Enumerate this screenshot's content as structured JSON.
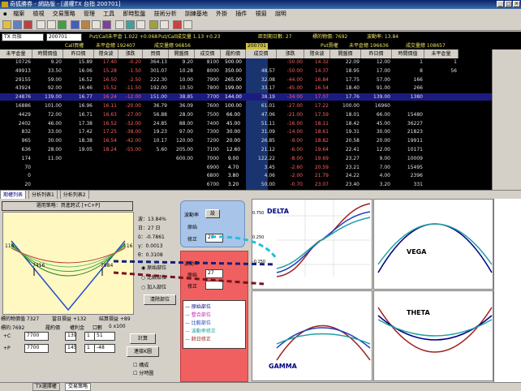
{
  "window": {
    "title": "奇狐勝券 - 網路版 - [選權TX 台指 200701]"
  },
  "menu": [
    "檔案",
    "檢視",
    "交易策略",
    "管理",
    "工具",
    "即時監盤",
    "技術分析",
    "訓練基地",
    "外掛",
    "插件",
    "視窗",
    "說明"
  ],
  "infobar": {
    "product": "TX 台指",
    "month": "200701",
    "call_info": "Put/Call未平倉 1.022 +0.068",
    "put_info": "Put/Call成交量 1.13 +0.23",
    "days_label": "距到期日數: 27",
    "underlying": "標的物價: 7692",
    "volatility": "波動率: 13.84"
  },
  "subheader": {
    "call_label": "Call買權",
    "call_oi": "未平倉總 192407",
    "call_vol": "成交量總 96856",
    "month": "200701",
    "put_label": "Put賣權",
    "put_oi": "未平倉總 196636",
    "put_vol": "成交量總 108657"
  },
  "grid": {
    "headers": [
      "未平倉量",
      "時間價值",
      "昨日價",
      "隱含波",
      "漲跌",
      "買價",
      "開盤價",
      "成交價",
      "履約價",
      "成交價",
      "漲跌",
      "隱含波",
      "開盤價",
      "昨日價",
      "時間價值",
      "未平倉量"
    ],
    "rows": [
      [
        "10726",
        "9.20",
        "15.89",
        "17.40",
        "-0.20",
        "364.13",
        "9.20",
        "8100",
        "500.00",
        "",
        "-50.00",
        "14.32",
        "22.09",
        "12.00",
        "1",
        "1"
      ],
      [
        "49913",
        "33.50",
        "16.06",
        "15.28",
        "-1.50",
        "301.07",
        "10.28",
        "8000",
        "350.00",
        "48.57",
        "-50.00",
        "14.37",
        "18.95",
        "17.00",
        "8",
        "56"
      ],
      [
        "29155",
        "59.00",
        "16.52",
        "16.50",
        "-2.50",
        "222.30",
        "10.00",
        "7900",
        "265.00",
        "32.08",
        "-44.00",
        "16.84",
        "17.75",
        "57.00",
        "166",
        ""
      ],
      [
        "43924",
        "92.00",
        "16.46",
        "15.52",
        "-11.50",
        "192.00",
        "10.50",
        "7800",
        "199.00",
        "33.17",
        "-45.00",
        "16.54",
        "18.40",
        "91.00",
        "266",
        ""
      ],
      [
        "24876",
        "139.00",
        "16.77",
        "16.24",
        "-12.00",
        "151.00",
        "38.85",
        "7700",
        "144.00",
        "38.19",
        "-34.00",
        "17.07",
        "17.76",
        "139.00",
        "1380",
        ""
      ],
      [
        "16886",
        "101.00",
        "16.96",
        "16.11",
        "-20.00",
        "36.79",
        "36.09",
        "7600",
        "100.00",
        "61.01",
        "-27.00",
        "17.22",
        "100.00",
        "16960",
        ""
      ],
      [
        "4429",
        "72.00",
        "16.71",
        "16.63",
        "-27.00",
        "56.88",
        "28.00",
        "7500",
        "66.00",
        "47.06",
        "-21.00",
        "17.59",
        "18.01",
        "66.00",
        "15480",
        ""
      ],
      [
        "2402",
        "46.00",
        "17.38",
        "16.52",
        "-32.00",
        "24.85",
        "88.00",
        "7400",
        "45.00",
        "51.11",
        "-16.00",
        "18.11",
        "18.42",
        "45.00",
        "36227",
        ""
      ],
      [
        "832",
        "33.00",
        "17.42",
        "17.25",
        "-38.00",
        "19.23",
        "97.00",
        "7300",
        "30.00",
        "31.09",
        "-14.00",
        "18.61",
        "19.31",
        "30.00",
        "21823",
        ""
      ],
      [
        "965",
        "30.00",
        "18.38",
        "16.54",
        "-42.00",
        "10.17",
        "120.00",
        "7200",
        "20.00",
        "26.85",
        "-9.00",
        "18.82",
        "20.58",
        "20.00",
        "19911",
        ""
      ],
      [
        "636",
        "28.00",
        "19.05",
        "18.24",
        "-55.00",
        "5.60",
        "205.00",
        "7100",
        "12.60",
        "21.12",
        "-6.00",
        "19.64",
        "22.41",
        "12.00",
        "10171",
        ""
      ],
      [
        "174",
        "11.00",
        "",
        "",
        "",
        "",
        "600.00",
        "7000",
        "9.00",
        "122.22",
        "-8.00",
        "19.69",
        "23.27",
        "9.00",
        "10009",
        ""
      ],
      [
        "70",
        "",
        "",
        "",
        "",
        "",
        "",
        "6900",
        "4.70",
        "3.45",
        "-2.60",
        "20.59",
        "23.21",
        "7.00",
        "15495",
        ""
      ],
      [
        "0",
        "",
        "",
        "",
        "",
        "",
        "",
        "6800",
        "3.80",
        "4.06",
        "-2.00",
        "21.79",
        "24.22",
        "4.00",
        "2396",
        ""
      ],
      [
        "20",
        "",
        "",
        "",
        "",
        "",
        "",
        "6700",
        "3.20",
        "50.00",
        "-0.70",
        "23.07",
        "23.40",
        "3.20",
        "331",
        ""
      ]
    ]
  },
  "tabs": [
    "期權列表",
    "分析列表1",
    "分析列表2"
  ],
  "strategy": {
    "select_label": "選用策略：買進跨式 [+C+P]",
    "chart_strike_left": "116",
    "chart_strike_right": "116",
    "tick_left": "7416",
    "tick_right": "7984",
    "greeks": [
      "波：13.84%",
      "日：27 日",
      "δ：-0.7861",
      "γ：0.0013",
      "θ：0.3108"
    ],
    "vol_labels": [
      "波動率",
      "原始",
      "修正"
    ],
    "vol_value": "20",
    "vol2_labels": [
      "波動率",
      "原始",
      "修正"
    ],
    "vol2_value": "27",
    "radio": [
      "原始部位",
      "比較部位",
      "加入部位"
    ],
    "clear_btn": "清除部位",
    "row1": {
      "label": "標的物價值 7327",
      "a": "當日損益 +132",
      "b": "結算損益 +89"
    },
    "row2": {
      "label": "標的:7692",
      "a": "履約價",
      "b": "權利金",
      "c": "口數",
      "d": "δ x100"
    },
    "entries": [
      {
        "strike": "7700",
        "prem": "139",
        "qty": "1",
        "delta": "51"
      },
      {
        "strike": "7700",
        "prem": "145",
        "qty": "1",
        "delta": "-48"
      }
    ],
    "calc_btn": "計算",
    "connect_btn": "連接K圖",
    "checks": [
      "構成",
      "分時圖"
    ],
    "legend": [
      "原始部位",
      "整合部位",
      "比較部位",
      "波動率修正",
      "餘日修正"
    ]
  },
  "charts": {
    "delta": "DELTA",
    "vega": "VEGA",
    "theta": "THETA",
    "gamma": "GAMMA",
    "xticks": [
      "7700",
      "7800",
      "7900",
      "8000",
      "8100"
    ],
    "ytick_tl": [
      "0.750",
      "0.500",
      "0.250",
      "0.000",
      "-0.250",
      "-0.500",
      "-0.750"
    ],
    "ytick_tr": [
      "14.2",
      "12.6",
      "11.2",
      "9.5",
      "7.9",
      "6.2",
      "4.7"
    ],
    "ytick_bl": [
      "0.0018",
      "0.0015",
      "0.0013",
      "0.0011",
      "0.0009",
      "0.0007",
      "0.0005"
    ],
    "ytick_br": [
      "-1.00",
      "-1.87",
      "-2.50",
      "-3.27",
      "-4.00",
      "-4.77",
      "-5.50"
    ]
  },
  "status": {
    "tab1": "TX選擇權",
    "tab2": "交易策略"
  }
}
